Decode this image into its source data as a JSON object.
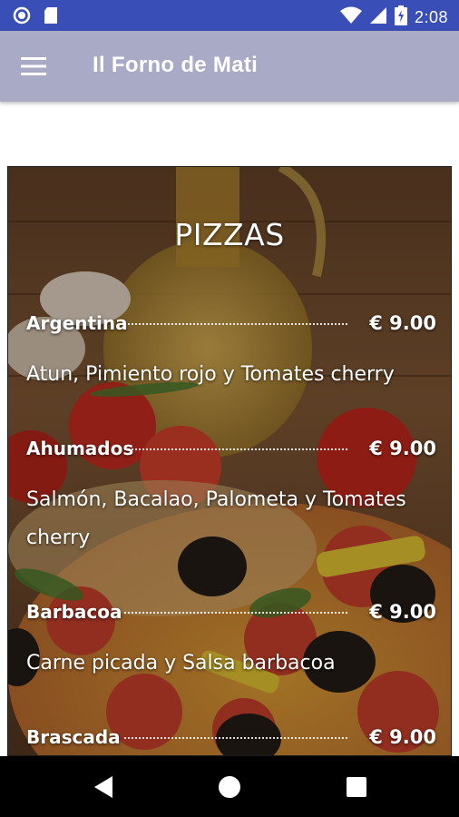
{
  "status_bar": {
    "time": "2:08",
    "icons": [
      "circle-notification-icon",
      "sd-card-icon",
      "wifi-icon",
      "signal-icon",
      "battery-icon"
    ]
  },
  "app_bar": {
    "title": "Il Forno de Mati",
    "menu_icon": "hamburger-menu-icon",
    "color": "#a8aac6"
  },
  "menu": {
    "section_title": "PIZZAS",
    "items": [
      {
        "name": "Argentina",
        "price": "€ 9.00",
        "description": "Atun, Pimiento rojo y Tomates cherry"
      },
      {
        "name": "Ahumados",
        "price": "€ 9.00",
        "description": "Salmón, Bacalao, Palometa y Tomates cherry"
      },
      {
        "name": "Barbacoa",
        "price": "€ 9.00",
        "description": "Carne picada y Salsa barbacoa"
      },
      {
        "name": "Brascada",
        "price": "€ 9.00",
        "description": ""
      }
    ]
  },
  "nav_bar": {
    "buttons": [
      "back-icon",
      "home-icon",
      "recents-icon"
    ]
  },
  "colors": {
    "status_bar": "#3a4eb8",
    "nav_bar": "#000000",
    "text": "#ffffff"
  }
}
